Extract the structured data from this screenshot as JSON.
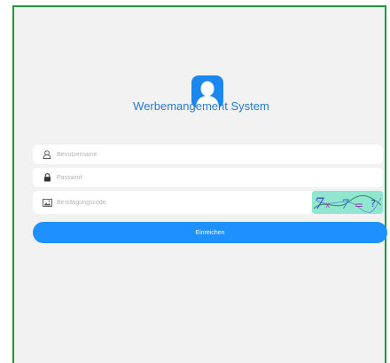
{
  "app": {
    "title": "Werbemangement System",
    "accent_color": "#1c87ef",
    "frame_color": "#1f9a3a"
  },
  "form": {
    "username": {
      "placeholder": "Benutzername",
      "value": "",
      "icon": "user-icon"
    },
    "password": {
      "placeholder": "Passwort",
      "value": "",
      "icon": "lock-icon"
    },
    "captcha": {
      "placeholder": "Bestätigungscode",
      "value": "",
      "icon": "image-icon",
      "image_text": "7x7=?"
    },
    "submit_label": "Einreichen"
  }
}
